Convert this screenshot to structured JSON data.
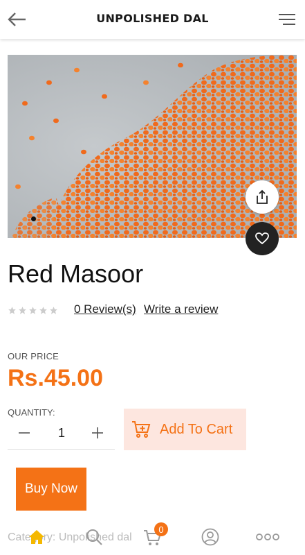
{
  "header": {
    "title": "UNPOLISHED DAL"
  },
  "product": {
    "name": "Red Masoor",
    "reviews_text": "0 Review(s)",
    "write_review_text": "Write a review",
    "rating": 0,
    "rating_max": 5,
    "price_label": "OUR PRICE",
    "price": "Rs.45.00",
    "quantity_label": "QUANTITY:",
    "quantity": "1",
    "add_to_cart_label": "Add To Cart",
    "buy_now_label": "Buy Now",
    "category_text": "Category: Unpolished dal",
    "image_dots": 1
  },
  "bottom_nav": {
    "cart_count": "0",
    "items": [
      "home-icon",
      "search-icon",
      "cart-icon",
      "user-icon",
      "more-icon"
    ]
  },
  "colors": {
    "accent": "#f47216",
    "add_cart_bg": "#fde6df"
  }
}
